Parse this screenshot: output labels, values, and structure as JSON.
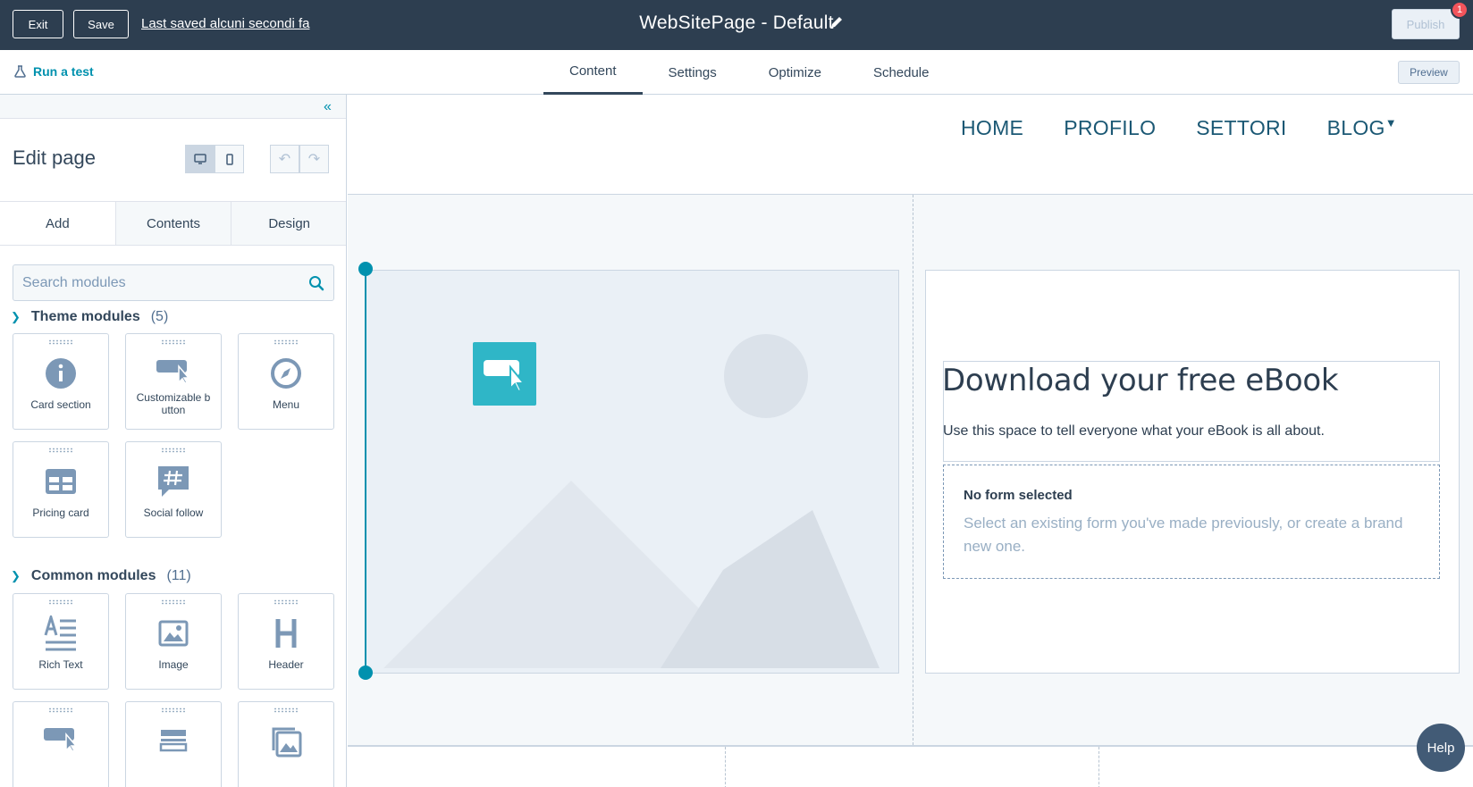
{
  "topbar": {
    "exit_label": "Exit",
    "save_label": "Save",
    "saved_status": "Last saved alcuni secondi fa",
    "page_title": "WebSitePage - Default",
    "publish_label": "Publish",
    "notification_count": "1"
  },
  "subbar": {
    "run_test_label": "Run a test",
    "tabs": [
      {
        "label": "Content",
        "active": true
      },
      {
        "label": "Settings",
        "active": false
      },
      {
        "label": "Optimize",
        "active": false
      },
      {
        "label": "Schedule",
        "active": false
      }
    ],
    "preview_label": "Preview"
  },
  "sidebar": {
    "title": "Edit page",
    "tabs": [
      {
        "label": "Add",
        "active": true
      },
      {
        "label": "Contents",
        "active": false
      },
      {
        "label": "Design",
        "active": false
      }
    ],
    "search_placeholder": "Search modules",
    "theme_section": {
      "title": "Theme modules",
      "count": "(5)"
    },
    "theme_modules": [
      {
        "label": "Card section",
        "icon": "info-circle-icon"
      },
      {
        "label": "Customizable b utton",
        "icon": "button-cursor-icon"
      },
      {
        "label": "Menu",
        "icon": "compass-icon"
      },
      {
        "label": "Pricing card",
        "icon": "pricing-table-icon"
      },
      {
        "label": "Social follow",
        "icon": "hashtag-bubble-icon"
      }
    ],
    "common_section": {
      "title": "Common modules",
      "count": "(11)"
    },
    "common_modules": [
      {
        "label": "Rich Text",
        "icon": "rich-text-icon"
      },
      {
        "label": "Image",
        "icon": "image-icon"
      },
      {
        "label": "Header",
        "icon": "header-icon"
      }
    ]
  },
  "canvas": {
    "nav": [
      "HOME",
      "PROFILO",
      "SETTORI",
      "BLOG"
    ],
    "ebook_title": "Download your free eBook",
    "ebook_desc": "Use this space to tell everyone what your eBook is all about.",
    "form_title": "No form selected",
    "form_desc": "Select an existing form you've made previously, or create a brand new one."
  },
  "help_label": "Help",
  "colors": {
    "topbar": "#2d3e50",
    "accent": "#0091ae",
    "badge": "#f2545b",
    "button_tile": "#2fb6c7"
  }
}
